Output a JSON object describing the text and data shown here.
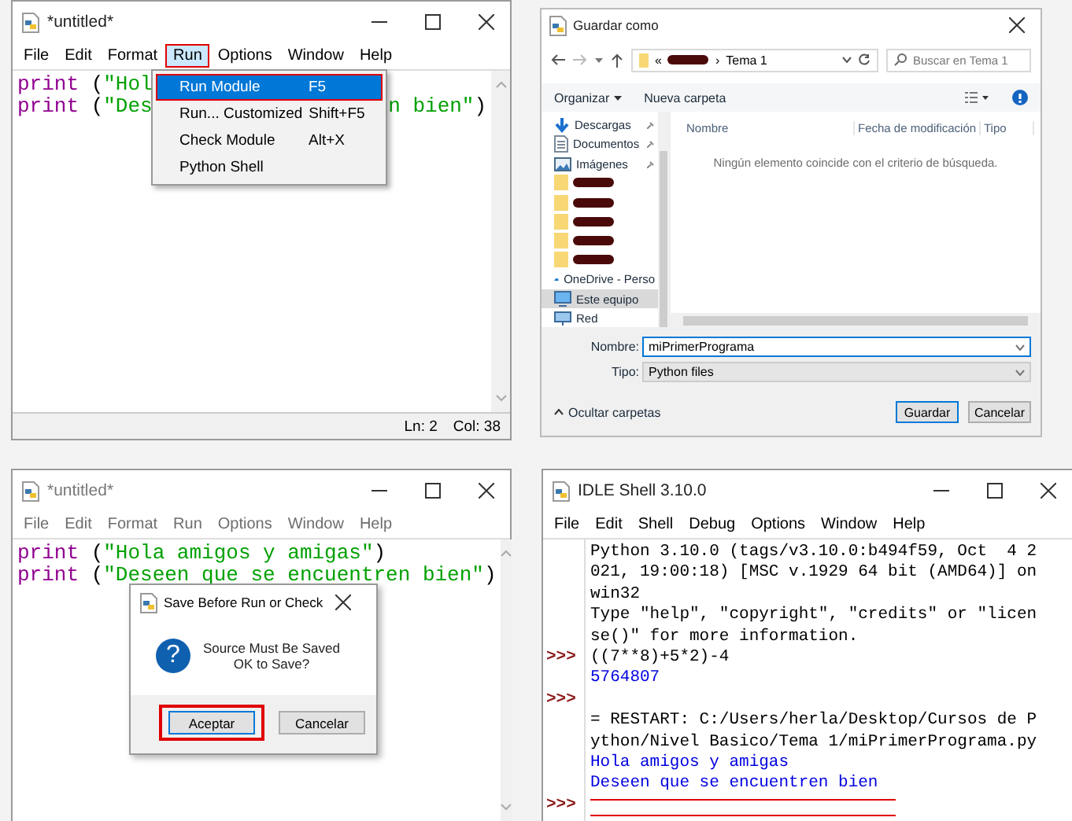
{
  "editor_with_run_menu": {
    "title": "*untitled*",
    "menus": [
      {
        "label": "File",
        "selected": false,
        "outlined": false
      },
      {
        "label": "Edit",
        "selected": false,
        "outlined": false
      },
      {
        "label": "Format",
        "selected": false,
        "outlined": false
      },
      {
        "label": "Run",
        "selected": true,
        "outlined": true
      },
      {
        "label": "Options",
        "selected": false,
        "outlined": false
      },
      {
        "label": "Window",
        "selected": false,
        "outlined": false
      },
      {
        "label": "Help",
        "selected": false,
        "outlined": false
      }
    ],
    "code_lines": [
      {
        "segments": [
          {
            "text": "print",
            "kind": "builtin"
          },
          {
            "text": " (",
            "kind": "plain"
          },
          {
            "text": "\"Hol",
            "kind": "string"
          }
        ]
      },
      {
        "segments": [
          {
            "text": "print",
            "kind": "builtin"
          },
          {
            "text": " (",
            "kind": "plain"
          },
          {
            "text": "\"Des",
            "kind": "string"
          }
        ],
        "tail": [
          {
            "text": "n bien\"",
            "kind": "string"
          },
          {
            "text": ")",
            "kind": "plain"
          }
        ]
      }
    ],
    "run_menu": [
      {
        "label": "Run Module",
        "shortcut": "F5",
        "selected": true,
        "outlined": true
      },
      {
        "label": "Run... Customized",
        "shortcut": "Shift+F5",
        "selected": false,
        "outlined": false
      },
      {
        "label": "Check Module",
        "shortcut": "Alt+X",
        "selected": false,
        "outlined": false
      },
      {
        "label": "Python Shell",
        "selected": false,
        "outlined": false
      }
    ],
    "status_bar": {
      "line": "Ln: 2",
      "column": "Col: 38"
    }
  },
  "save_dialog": {
    "title": "Guardar como",
    "breadcrumb": {
      "lead": "«",
      "separator": "›",
      "folder": "Tema 1"
    },
    "search": {
      "placeholder": "Buscar en Tema 1"
    },
    "toolbar": [
      {
        "label": "Organizar",
        "kind": "menu"
      },
      {
        "label": "Nueva carpeta",
        "kind": "plain"
      }
    ],
    "nav_items": [
      {
        "label": "Descargas",
        "kind": "downloads",
        "pinned": true,
        "selected": false
      },
      {
        "label": "Documentos",
        "kind": "documents",
        "pinned": true,
        "selected": false
      },
      {
        "label": "Imágenes",
        "kind": "pictures",
        "pinned": true,
        "selected": false
      },
      {
        "kind": "redacted-folder",
        "pinned": false,
        "selected": false
      },
      {
        "kind": "redacted-folder",
        "pinned": false,
        "selected": false
      },
      {
        "kind": "redacted-folder",
        "pinned": false,
        "selected": false
      },
      {
        "kind": "redacted-folder",
        "pinned": false,
        "selected": false
      },
      {
        "kind": "redacted-folder",
        "pinned": false,
        "selected": false
      },
      {
        "label": "OneDrive - Perso",
        "kind": "cloud",
        "pinned": false,
        "selected": false
      },
      {
        "label": "Este equipo",
        "kind": "computer",
        "pinned": false,
        "selected": true
      },
      {
        "label": "Red",
        "kind": "network",
        "pinned": false,
        "selected": false
      }
    ],
    "columns": [
      "Nombre",
      "Fecha de modificación",
      "Tipo"
    ],
    "empty_message": "Ningún elemento coincide con el criterio de búsqueda.",
    "fields": [
      {
        "label": "Nombre:",
        "value": "miPrimerPrograma",
        "kind": "input"
      },
      {
        "label": "Tipo:",
        "value": "Python files",
        "kind": "select"
      }
    ],
    "hide_folders": "Ocultar carpetas",
    "buttons": [
      {
        "label": "Guardar",
        "default": true
      },
      {
        "label": "Cancelar",
        "default": false
      }
    ]
  },
  "editor_with_save_prompt": {
    "title": "*untitled*",
    "menus": [
      {
        "label": "File",
        "disabled": true
      },
      {
        "label": "Edit",
        "disabled": true
      },
      {
        "label": "Format",
        "disabled": true
      },
      {
        "label": "Run",
        "disabled": true
      },
      {
        "label": "Options",
        "disabled": true
      },
      {
        "label": "Window",
        "disabled": true
      },
      {
        "label": "Help",
        "disabled": true
      }
    ],
    "code_lines": [
      {
        "segments": [
          {
            "text": "print",
            "kind": "builtin"
          },
          {
            "text": " (",
            "kind": "plain"
          },
          {
            "text": "\"Hola amigos y amigas\"",
            "kind": "string"
          },
          {
            "text": ")",
            "kind": "plain"
          }
        ]
      },
      {
        "segments": [
          {
            "text": "print",
            "kind": "builtin"
          },
          {
            "text": " (",
            "kind": "plain"
          },
          {
            "text": "\"Deseen que se encuentren bien\"",
            "kind": "string"
          },
          {
            "text": ")",
            "kind": "plain"
          }
        ]
      }
    ],
    "dialog": {
      "title": "Save Before Run or Check",
      "icon_glyph": "?",
      "message": "Source Must Be Saved\nOK to Save?",
      "buttons": [
        {
          "label": "Aceptar",
          "default": true,
          "outlined": true
        },
        {
          "label": "Cancelar",
          "default": false,
          "outlined": false
        }
      ]
    }
  },
  "shell": {
    "title": "IDLE Shell 3.10.0",
    "menus": [
      "File",
      "Edit",
      "Shell",
      "Debug",
      "Options",
      "Window",
      "Help"
    ],
    "lines": [
      {
        "text": "Python 3.10.0 (tags/v3.10.0:b494f59, Oct  4 2",
        "kind": "output",
        "underlined": false
      },
      {
        "text": "021, 19:00:18) [MSC v.1929 64 bit (AMD64)] on",
        "kind": "output",
        "underlined": false
      },
      {
        "text": "win32",
        "kind": "output",
        "underlined": false
      },
      {
        "text": "Type \"help\", \"copyright\", \"credits\" or \"licen",
        "kind": "output",
        "underlined": false
      },
      {
        "text": "se()\" for more information.",
        "kind": "output",
        "underlined": false
      },
      {
        "prompt": ">>>",
        "text": "((7**8)+5*2)-4",
        "kind": "input",
        "underlined": false
      },
      {
        "text": "5764807",
        "kind": "result",
        "underlined": false
      },
      {
        "prompt": ">>>",
        "kind": "input",
        "underlined": false
      },
      {
        "text": "= RESTART: C:/Users/herla/Desktop/Cursos de P",
        "kind": "output",
        "underlined": false
      },
      {
        "text": "ython/Nivel Basico/Tema 1/miPrimerPrograma.py",
        "kind": "output",
        "underlined": false
      },
      {
        "text": "Hola amigos y amigas",
        "kind": "result",
        "underlined": false
      },
      {
        "text": "Deseen que se encuentren bien",
        "kind": "result",
        "underlined": false
      },
      {
        "prompt": ">>>",
        "kind": "input",
        "underlined": true
      }
    ]
  }
}
